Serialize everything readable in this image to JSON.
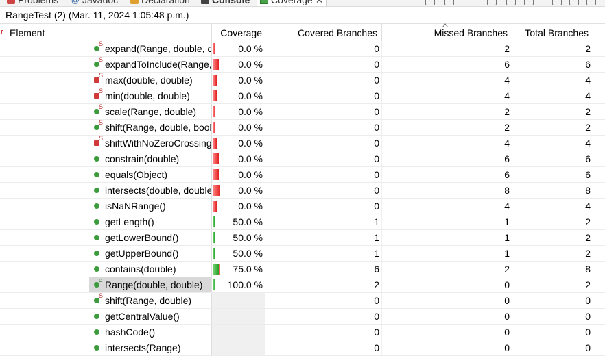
{
  "tabs": [
    {
      "label": "Problems",
      "icon": "problems-icon",
      "active": false
    },
    {
      "label": "Javadoc",
      "icon": "javadoc-icon",
      "active": false
    },
    {
      "label": "Declaration",
      "icon": "declaration-icon",
      "active": false
    },
    {
      "label": "Console",
      "icon": "console-icon",
      "active": true
    },
    {
      "label": "Coverage",
      "icon": "coverage-icon",
      "active": false,
      "closeable": true
    }
  ],
  "session": "RangeTest (2) (Mar. 11, 2024 1:05:48 p.m.)",
  "columns": {
    "element": "Element",
    "coverage": "Coverage",
    "covered": "Covered Branches",
    "missed": "Missed Branches",
    "total": "Total Branches"
  },
  "colors": {
    "missed": "#e02020",
    "covered": "#24a024",
    "method": "#3d9b3d"
  },
  "rows": [
    {
      "label": "expand(Range, double, double)",
      "icon": "static-public-method-icon",
      "coverage": "0.0 %",
      "covered": "0",
      "missed": "2",
      "total": "2"
    },
    {
      "label": "expandToInclude(Range, double)",
      "icon": "static-public-method-icon",
      "coverage": "0.0 %",
      "covered": "0",
      "missed": "6",
      "total": "6"
    },
    {
      "label": "max(double, double)",
      "icon": "static-private-method-icon",
      "coverage": "0.0 %",
      "covered": "0",
      "missed": "4",
      "total": "4"
    },
    {
      "label": "min(double, double)",
      "icon": "static-private-method-icon",
      "coverage": "0.0 %",
      "covered": "0",
      "missed": "4",
      "total": "4"
    },
    {
      "label": "scale(Range, double)",
      "icon": "static-public-method-icon",
      "coverage": "0.0 %",
      "covered": "0",
      "missed": "2",
      "total": "2"
    },
    {
      "label": "shift(Range, double, boolean)",
      "icon": "static-public-method-icon",
      "coverage": "0.0 %",
      "covered": "0",
      "missed": "2",
      "total": "2"
    },
    {
      "label": "shiftWithNoZeroCrossing(double, double)",
      "icon": "static-private-method-icon",
      "coverage": "0.0 %",
      "covered": "0",
      "missed": "4",
      "total": "4"
    },
    {
      "label": "constrain(double)",
      "icon": "public-method-icon",
      "coverage": "0.0 %",
      "covered": "0",
      "missed": "6",
      "total": "6"
    },
    {
      "label": "equals(Object)",
      "icon": "public-method-icon",
      "coverage": "0.0 %",
      "covered": "0",
      "missed": "6",
      "total": "6"
    },
    {
      "label": "intersects(double, double)",
      "icon": "public-method-icon",
      "coverage": "0.0 %",
      "covered": "0",
      "missed": "8",
      "total": "8"
    },
    {
      "label": "isNaNRange()",
      "icon": "public-method-icon",
      "coverage": "0.0 %",
      "covered": "0",
      "missed": "4",
      "total": "4"
    },
    {
      "label": "getLength()",
      "icon": "public-method-icon",
      "coverage": "50.0 %",
      "covered": "1",
      "missed": "1",
      "total": "2"
    },
    {
      "label": "getLowerBound()",
      "icon": "public-method-icon",
      "coverage": "50.0 %",
      "covered": "1",
      "missed": "1",
      "total": "2"
    },
    {
      "label": "getUpperBound()",
      "icon": "public-method-icon",
      "coverage": "50.0 %",
      "covered": "1",
      "missed": "1",
      "total": "2"
    },
    {
      "label": "contains(double)",
      "icon": "public-method-icon",
      "coverage": "75.0 %",
      "covered": "6",
      "missed": "2",
      "total": "8"
    },
    {
      "label": "Range(double, double)",
      "icon": "constructor-icon",
      "coverage": "100.0 %",
      "covered": "2",
      "missed": "0",
      "total": "2",
      "selected": true
    },
    {
      "label": "shift(Range, double)",
      "icon": "static-public-method-icon",
      "coverage": "",
      "covered": "0",
      "missed": "0",
      "total": "0"
    },
    {
      "label": "getCentralValue()",
      "icon": "public-method-icon",
      "coverage": "",
      "covered": "0",
      "missed": "0",
      "total": "0"
    },
    {
      "label": "hashCode()",
      "icon": "public-method-icon",
      "coverage": "",
      "covered": "0",
      "missed": "0",
      "total": "0"
    },
    {
      "label": "intersects(Range)",
      "icon": "public-method-icon",
      "coverage": "",
      "covered": "0",
      "missed": "0",
      "total": "0"
    }
  ]
}
